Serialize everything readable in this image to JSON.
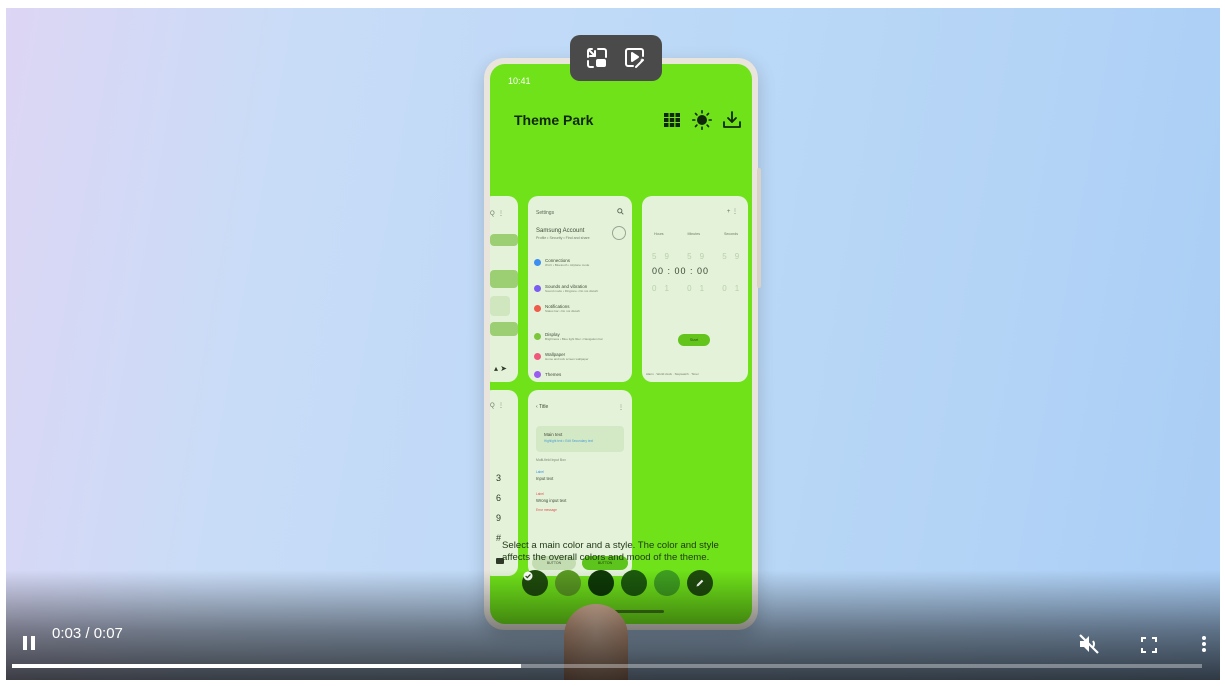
{
  "player": {
    "time_display": "0:03 / 0:07",
    "progress_fraction": 0.428,
    "controls": [
      "pause-icon",
      "volume-off-icon",
      "fullscreen-icon",
      "more-vert-icon"
    ]
  },
  "floating_toolbar": {
    "icons": [
      "pop-out-window-icon",
      "video-magic-icon"
    ]
  },
  "phone": {
    "status_time": "10:41",
    "app_title": "Theme Park",
    "header_icons": [
      "grid-icon",
      "brightness-icon",
      "download-icon"
    ],
    "description": "Select a main color and a style. The color and style affects the overall colors and mood of the theme.",
    "swatch_colors": [
      "#1e4c0c",
      "#5a9a22",
      "#0e3a07",
      "#1c5a0d",
      "#3fa020",
      "#1e4c0c"
    ],
    "selected_swatch": 0,
    "screen_color": "#6fe21a"
  },
  "preview_cards": {
    "settings": {
      "title": "Settings",
      "account": "Samsung Account",
      "account_sub": "Profile • Security • Find and share",
      "items": [
        {
          "label": "Connections",
          "sub": "Wi-Fi • Bluetooth • Airplane mode",
          "color": "#3d8ef0"
        },
        {
          "label": "Sounds and vibration",
          "sub": "Sound mode • Ringtone • Do not disturb",
          "color": "#7a5cf0"
        },
        {
          "label": "Notifications",
          "sub": "Status bar • Do not disturb",
          "color": "#f05a4a"
        },
        {
          "label": "Display",
          "sub": "Brightness • Blue light filter • Navigation bar",
          "color": "#7cc63c"
        },
        {
          "label": "Wallpaper",
          "sub": "Home and lock screen wallpaper",
          "color": "#f0577c"
        },
        {
          "label": "Themes",
          "sub": "",
          "color": "#9b5cf0"
        }
      ]
    },
    "timer": {
      "labels": [
        "Hours",
        "Minutes",
        "Seconds"
      ],
      "digits": "00 : 00 : 00",
      "faint_top": "59 59 59",
      "faint_bottom": "01 01 01",
      "start": "Start",
      "tabs": "Alarm · World clock · Stopwatch · Timer"
    },
    "title_card": {
      "back": "Title",
      "main_text": "Main text",
      "highlight": "Highlight text • Edit Secondary text",
      "section": "Multi-field Input Box",
      "label1": "Label",
      "input1": "Input text",
      "label2": "Label",
      "input2": "Wrong input text",
      "error": "Error message",
      "button1": "BUTTON",
      "button2": "BUTTON"
    },
    "partial_numbers": [
      "3",
      "6",
      "9",
      "#"
    ]
  }
}
